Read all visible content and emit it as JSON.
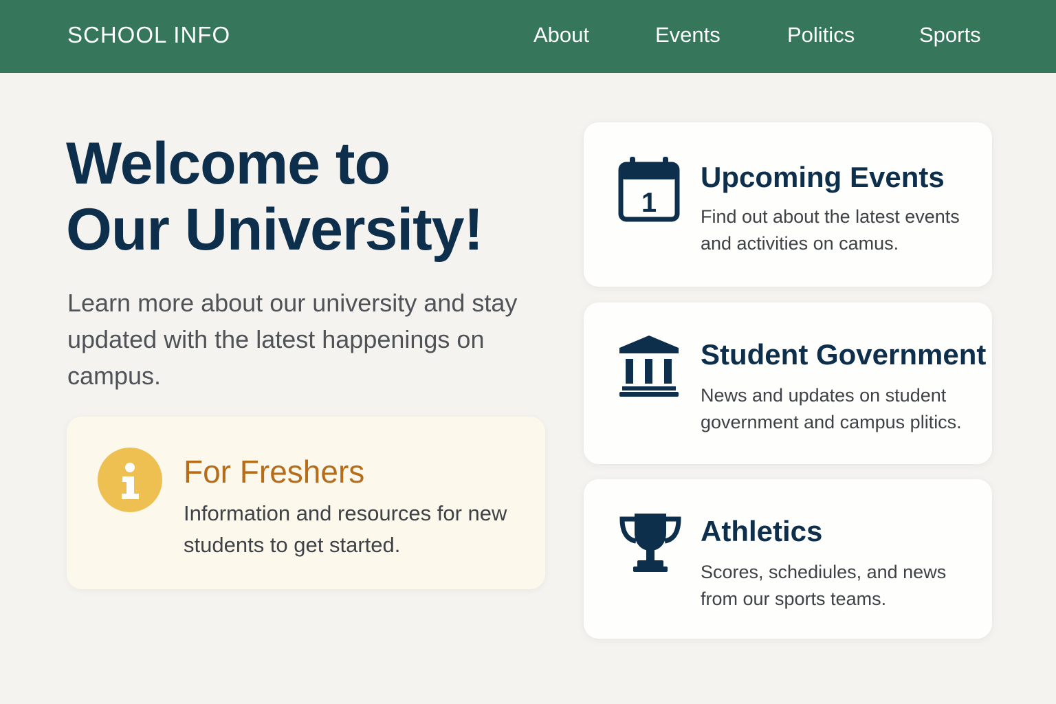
{
  "header": {
    "brand": "SCHOOL INFO",
    "nav": [
      {
        "label": "About"
      },
      {
        "label": "Events"
      },
      {
        "label": "Politics"
      },
      {
        "label": "Sports"
      }
    ]
  },
  "hero": {
    "title_line1": "Welcome to",
    "title_line2": "Our University!",
    "subtitle": "Learn more about our university and stay updated with the latest happenings on campus."
  },
  "freshers": {
    "icon": "info-icon",
    "title": "For Freshers",
    "text": "Information and resources for new students to get started."
  },
  "cards": [
    {
      "icon": "calendar-icon",
      "icon_text": "1",
      "title": "Upcoming Events",
      "text": "Find out about the latest events and activities on camus."
    },
    {
      "icon": "government-building-icon",
      "title": "Student Government",
      "text": "News and updates on student government and campus plitics."
    },
    {
      "icon": "trophy-icon",
      "title": "Athletics",
      "text": "Scores, schediules, and news from our sports teams."
    }
  ],
  "colors": {
    "header_bg": "#36775c",
    "page_bg": "#f4f3ef",
    "navy": "#0e2f4c",
    "freshers_accent": "#b56d1b",
    "info_badge": "#eec052"
  }
}
